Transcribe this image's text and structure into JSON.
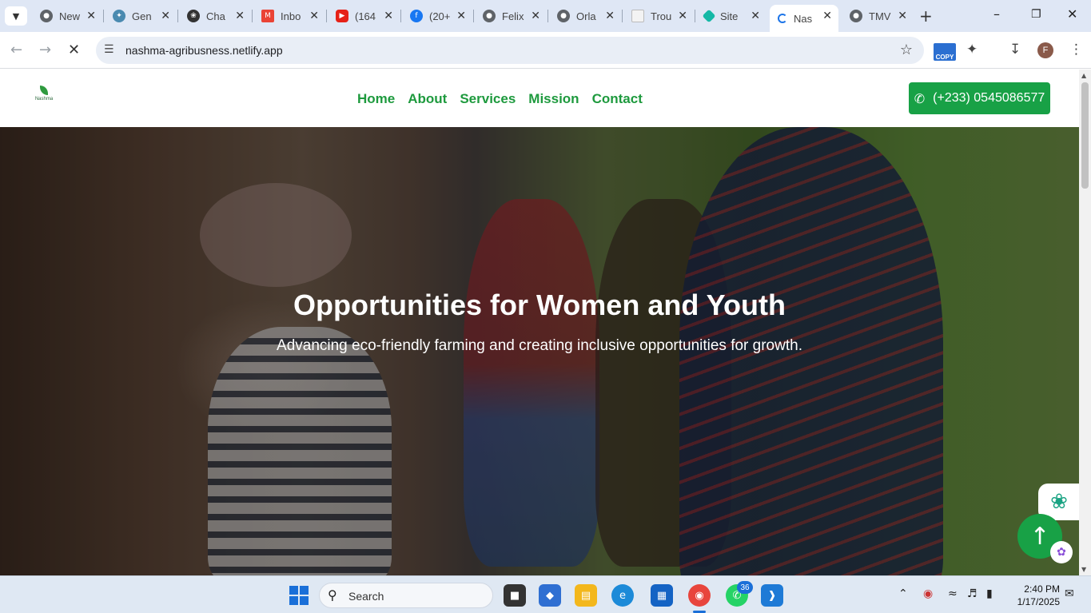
{
  "browser": {
    "tabs": [
      {
        "title": "New",
        "icon": "chrome-icon"
      },
      {
        "title": "Gen",
        "icon": "gemini-icon"
      },
      {
        "title": "Cha",
        "icon": "chatgpt-icon"
      },
      {
        "title": "Inbo",
        "icon": "gmail-icon"
      },
      {
        "title": "(164",
        "icon": "youtube-icon"
      },
      {
        "title": "(20+",
        "icon": "facebook-icon"
      },
      {
        "title": "Felix",
        "icon": "globe-icon"
      },
      {
        "title": "Orla",
        "icon": "globe-icon"
      },
      {
        "title": "Trou",
        "icon": "page-icon"
      },
      {
        "title": "Site",
        "icon": "netlify-icon"
      },
      {
        "title": "Nas",
        "icon": "loading-icon"
      },
      {
        "title": "TMV",
        "icon": "globe-icon"
      }
    ],
    "url": "nashma-agribusness.netlify.app",
    "copy_ext_label": "COPY",
    "profile_initial": "F"
  },
  "site": {
    "logo_text": "Nashma",
    "nav": [
      "Home",
      "About",
      "Services",
      "Mission",
      "Contact"
    ],
    "phone": "(+233) 0545086577",
    "hero_title": "Opportunities for Women and Youth",
    "hero_subtitle": "Advancing eco-friendly farming and creating inclusive opportunities for growth.",
    "accent_color": "#18a146"
  },
  "taskbar": {
    "search_label": "Search",
    "whatsapp_badge": "36",
    "time": "2:40 PM",
    "date": "1/17/2025"
  }
}
